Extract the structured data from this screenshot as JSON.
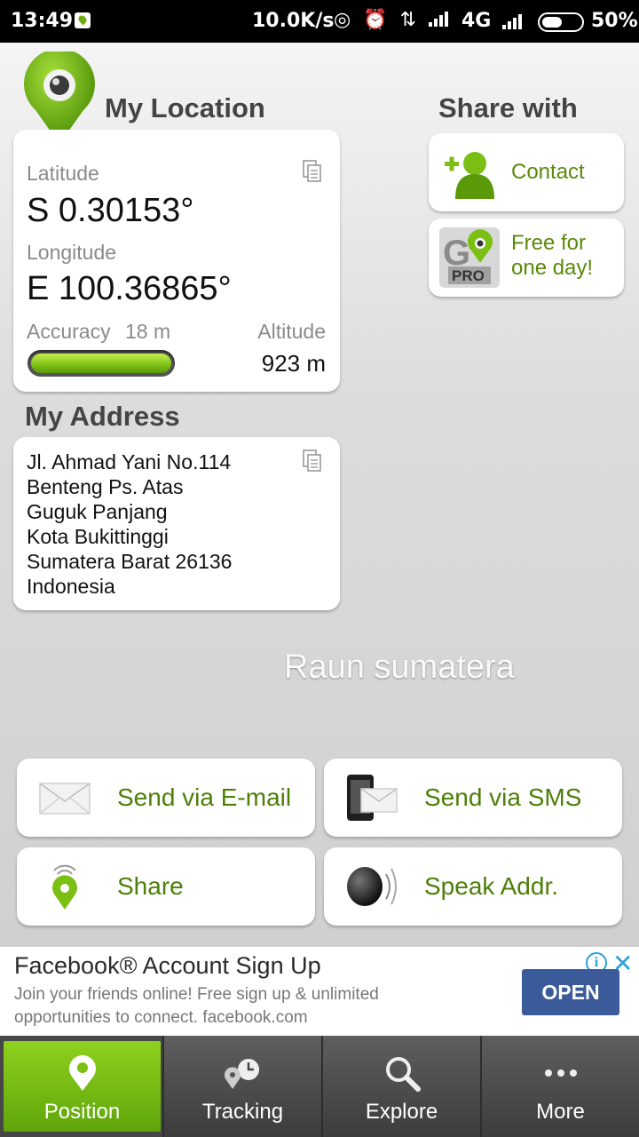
{
  "status_bar": {
    "time": "13:49",
    "speed": "10.0K/s",
    "network": "4G",
    "battery": "50%"
  },
  "location": {
    "title": "My Location",
    "latitude_label": "Latitude",
    "latitude_value": "S 0.30153°",
    "longitude_label": "Longitude",
    "longitude_value": "E 100.36865°",
    "accuracy_label": "Accuracy",
    "accuracy_value": "18 m",
    "altitude_label": "Altitude",
    "altitude_value": "923 m",
    "accuracy_fill_fraction": 1.0
  },
  "address": {
    "title": "My Address",
    "lines": [
      "Jl. Ahmad Yani No.114",
      "Benteng Ps. Atas",
      "Guguk Panjang",
      "Kota Bukittinggi",
      "Sumatera Barat 26136",
      "Indonesia"
    ]
  },
  "share": {
    "title": "Share with",
    "contact_label": "Contact",
    "pro_label_1": "Free for",
    "pro_label_2": "one day!",
    "pro_badge": "PRO"
  },
  "watermark": "Raun sumatera",
  "actions": {
    "email_label": "Send via E-mail",
    "sms_label": "Send via SMS",
    "share_label": "Share",
    "speak_label": "Speak Addr."
  },
  "ad": {
    "title": "Facebook® Account Sign Up",
    "body": "Join your friends online! Free sign up & unlimited opportunities to connect. facebook.com",
    "cta": "OPEN"
  },
  "tabs": [
    {
      "label": "Position",
      "icon": "pin-icon",
      "active": true
    },
    {
      "label": "Tracking",
      "icon": "tracking-icon",
      "active": false
    },
    {
      "label": "Explore",
      "icon": "magnifier-icon",
      "active": false
    },
    {
      "label": "More",
      "icon": "more-dots-icon",
      "active": false
    }
  ],
  "colors": {
    "accent_green": "#6fae10",
    "label_green": "#5a8a0a",
    "ad_button": "#3b5a9a"
  }
}
